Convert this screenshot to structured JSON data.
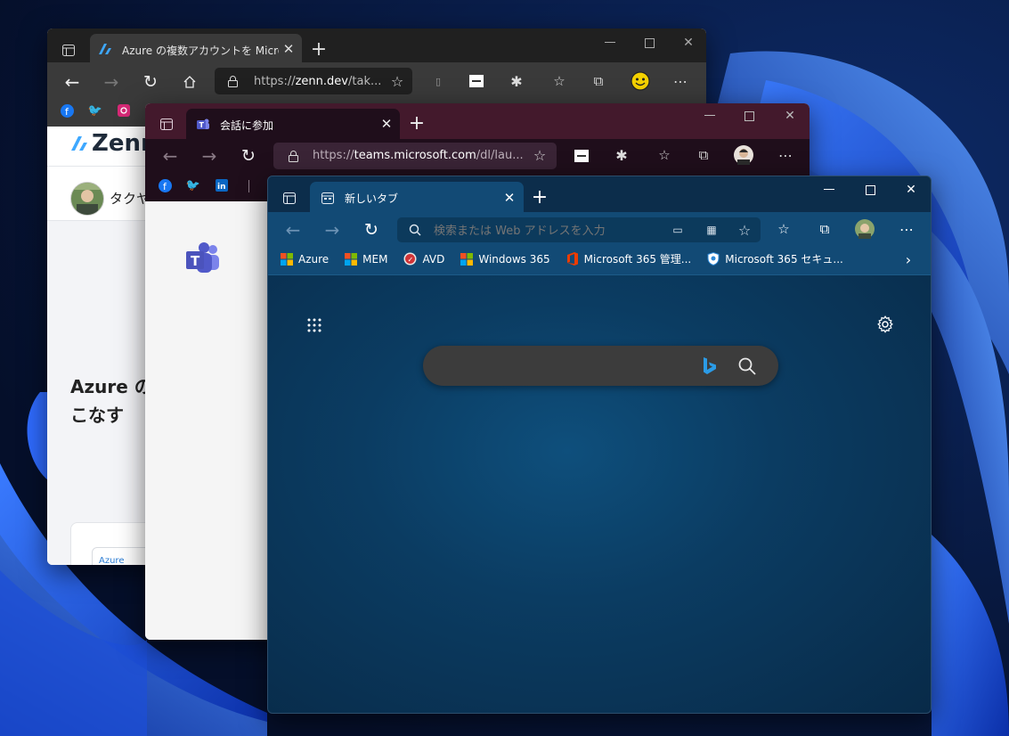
{
  "desktop": {
    "wallpaper": "windows-11-bloom-blue",
    "accent": "#1f5fff"
  },
  "windows": [
    {
      "id": "zenn",
      "theme": "#202020",
      "tab_title": "Azure の複数アカウントを Microsoft Edge",
      "address_prefix": "https://",
      "address_domain": "zenn.dev",
      "address_suffix": "/tak...",
      "favorites": [
        "facebook-icon",
        "twitter-icon",
        "instagram-icon"
      ],
      "page": {
        "logo": "Zenn",
        "author": "タクヤ",
        "article_title_line1": "Azure の",
        "article_title_line2": "こなす",
        "card_text": "Azure"
      }
    },
    {
      "id": "teams",
      "theme": "#43192c",
      "tab_title": "会話に参加",
      "address_prefix": "https://",
      "address_domain": "teams.microsoft.com",
      "address_suffix": "/dl/lau...",
      "favorites": [
        "facebook-icon",
        "twitter-icon",
        "linkedin-icon"
      ]
    },
    {
      "id": "newtab",
      "theme": "#124a75",
      "tab_title": "新しいタブ",
      "address_placeholder": "検索または Web アドレスを入力",
      "favorites": [
        {
          "label": "Azure",
          "icon": "microsoft-logo-icon"
        },
        {
          "label": "MEM",
          "icon": "microsoft-logo-icon"
        },
        {
          "label": "AVD",
          "icon": "avd-icon"
        },
        {
          "label": "Windows 365",
          "icon": "microsoft-logo-icon"
        },
        {
          "label": "Microsoft 365 管理...",
          "icon": "office-icon"
        },
        {
          "label": "Microsoft 365 セキュ...",
          "icon": "shield-icon"
        }
      ]
    }
  ]
}
